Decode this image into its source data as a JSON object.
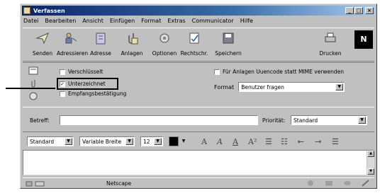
{
  "window": {
    "title": "Verfassen"
  },
  "menu": [
    "Datei",
    "Bearbeiten",
    "Ansicht",
    "Einfügen",
    "Format",
    "Extras",
    "Communicator",
    "Hilfe"
  ],
  "toolbar": {
    "items": [
      {
        "label": "Senden",
        "icon": "send-icon"
      },
      {
        "label": "Adressieren",
        "icon": "address-icon"
      },
      {
        "label": "Adresse",
        "icon": "address-book-icon"
      },
      {
        "label": "Anlagen",
        "icon": "attach-icon"
      },
      {
        "label": "Optionen",
        "icon": "options-icon"
      },
      {
        "label": "Rechtschr.",
        "icon": "spellcheck-icon"
      },
      {
        "label": "Speichern",
        "icon": "save-icon"
      },
      {
        "label": "Drucken",
        "icon": "print-icon"
      }
    ],
    "logo": "N"
  },
  "options": {
    "checkboxes": [
      {
        "label": "Verschlüsselt",
        "checked": false
      },
      {
        "label": "Unterzeichnet",
        "checked": true
      },
      {
        "label": "Empfangsbestätigung",
        "checked": false
      }
    ],
    "uuencode_label": "Für Anlagen Uuencode statt MIME verwenden",
    "format_label": "Format",
    "format_value": "Benutzer fragen"
  },
  "subject": {
    "label": "Betreff:",
    "value": "",
    "priority_label": "Priorität:",
    "priority_value": "Standard"
  },
  "formatting": {
    "style": "Standard",
    "font": "Variable Breite",
    "size": "12",
    "buttons": [
      "A",
      "A",
      "A",
      "A²",
      "☰",
      "☷",
      "⇤",
      "⇥",
      "☰"
    ]
  },
  "status": {
    "text": "Netscape"
  }
}
